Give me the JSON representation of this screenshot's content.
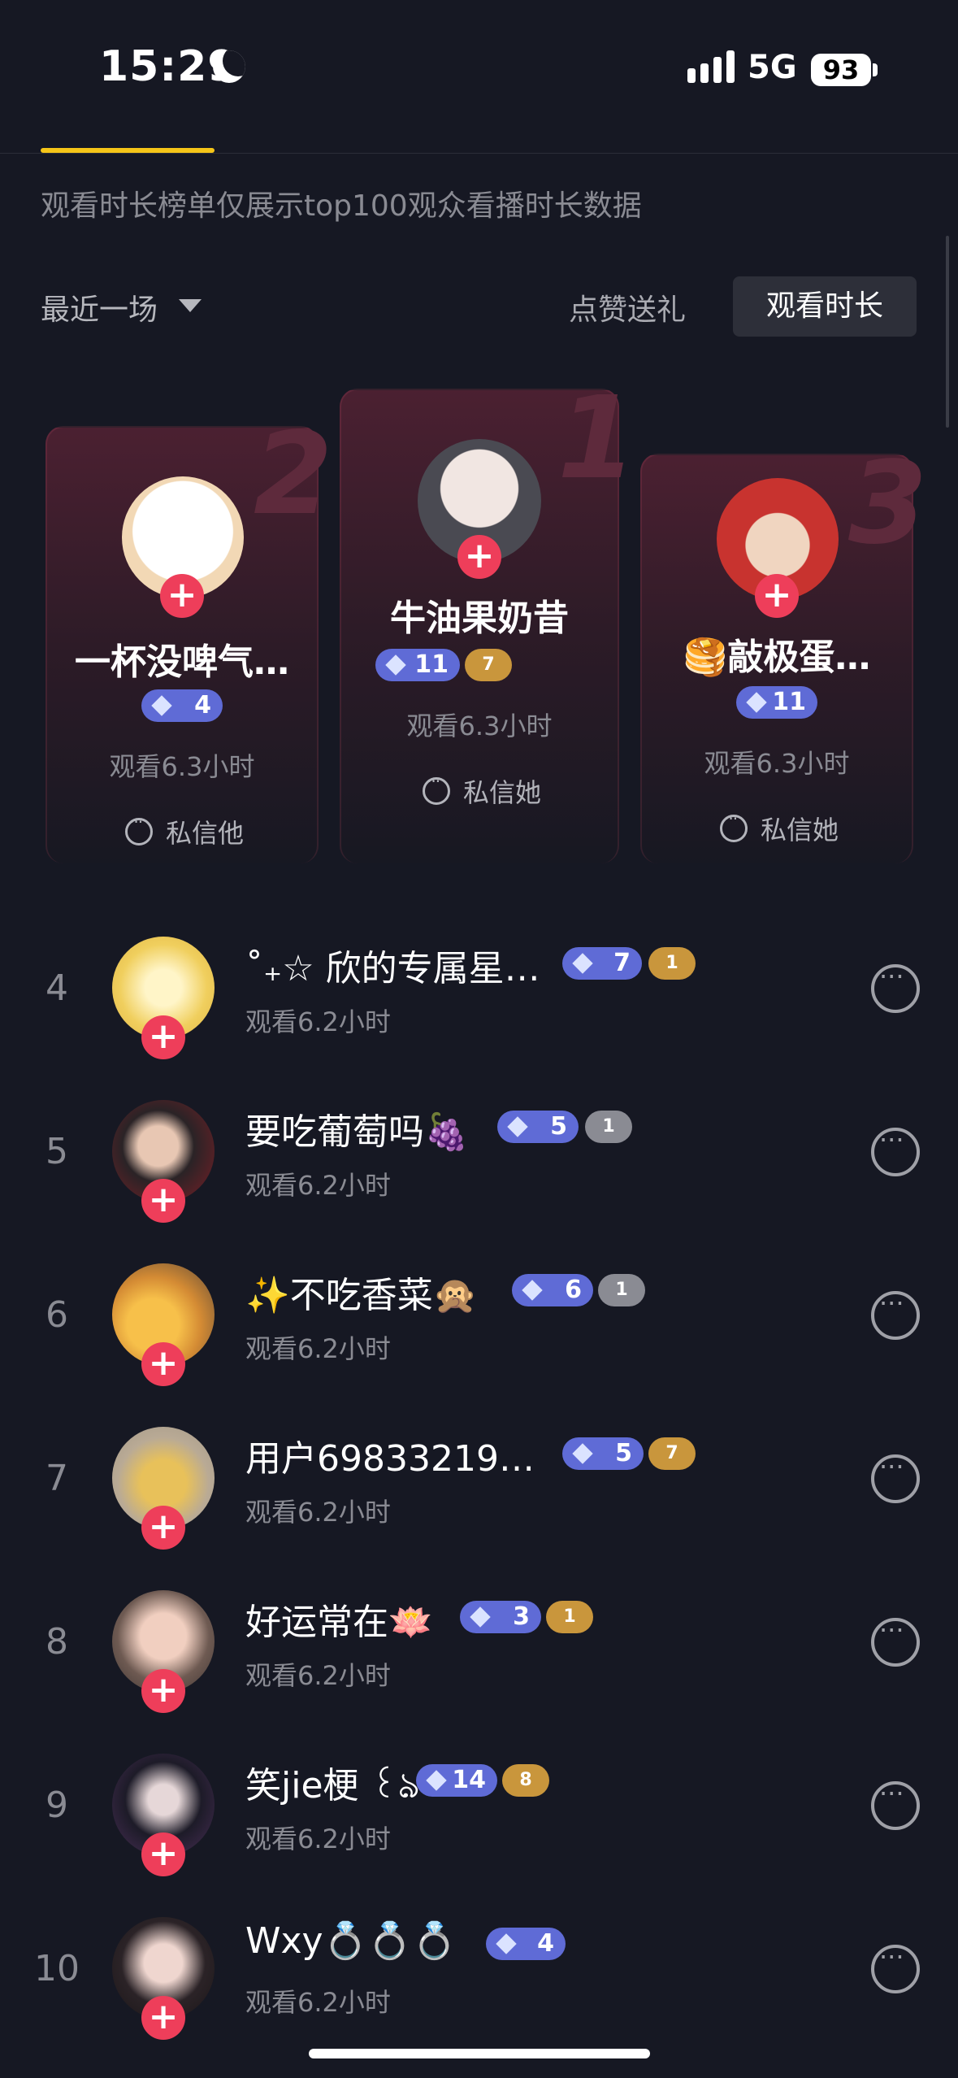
{
  "status": {
    "time": "15:29",
    "network": "5G",
    "battery": "93"
  },
  "notice": "观看时长榜单仅展示top100观众看播时长数据",
  "filter": {
    "label": "最近一场"
  },
  "segments": {
    "likes_gifts": "点赞送礼",
    "watch_time": "观看时长"
  },
  "podium": [
    {
      "rank": "2",
      "name": "一杯没啤气…",
      "level": "4",
      "watch": "观看6.3小时",
      "message": "私信他"
    },
    {
      "rank": "1",
      "name": "牛油果奶昔",
      "level": "11",
      "medal": "7",
      "watch": "观看6.3小时",
      "message": "私信她"
    },
    {
      "rank": "3",
      "name": "🥞敲极蛋…",
      "level": "11",
      "watch": "观看6.3小时",
      "message": "私信她"
    }
  ],
  "list": [
    {
      "rank": "4",
      "name": "˚₊☆ 欣的专属星…",
      "level": "7",
      "medal": "1",
      "watch": "观看6.2小时"
    },
    {
      "rank": "5",
      "name": "要吃葡萄吗🍇",
      "level": "5",
      "medal": "1",
      "watch": "观看6.2小时"
    },
    {
      "rank": "6",
      "name": "✨不吃香菜🙊",
      "level": "6",
      "medal": "1",
      "watch": "观看6.2小时"
    },
    {
      "rank": "7",
      "name": "用户69833219…",
      "level": "5",
      "medal": "7",
      "watch": "观看6.2小时"
    },
    {
      "rank": "8",
      "name": "好运常在🪷",
      "level": "3",
      "medal": "1",
      "watch": "观看6.2小时"
    },
    {
      "rank": "9",
      "name": "笑jie梗 ꒰ঌ",
      "level": "14",
      "medal": "8",
      "watch": "观看6.2小时"
    },
    {
      "rank": "10",
      "name": "Wxy💍💍💍",
      "level": "4",
      "watch": "观看6.2小时"
    }
  ]
}
